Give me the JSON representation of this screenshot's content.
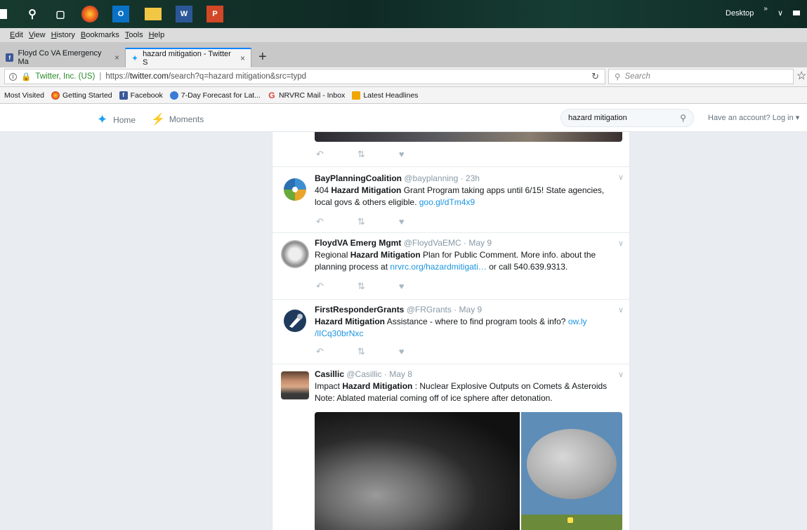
{
  "taskbar": {
    "right_label": "Desktop",
    "chevron": "»"
  },
  "menubar": [
    "Edit",
    "View",
    "History",
    "Bookmarks",
    "Tools",
    "Help"
  ],
  "tabs": [
    {
      "label": "Floyd Co VA Emergency Ma",
      "close": "×"
    },
    {
      "label": "hazard mitigation - Twitter S",
      "close": "×"
    }
  ],
  "newtab": "+",
  "url": {
    "org": "Twitter, Inc. (US)",
    "prefix": "https://",
    "host": "twitter.com",
    "path": "/search?q=hazard mitigation&src=typd"
  },
  "search_placeholder": "Search",
  "bookmarks": [
    {
      "label": "Most Visited"
    },
    {
      "label": "Getting Started"
    },
    {
      "label": "Facebook"
    },
    {
      "label": "7-Day Forecast for Lat..."
    },
    {
      "label": "NRVRC Mail - Inbox"
    },
    {
      "label": "Latest Headlines"
    }
  ],
  "twitter_nav": {
    "home": "Home",
    "moments": "Moments",
    "search_value": "hazard mitigation",
    "login": "Have an account? Log in ▾"
  },
  "tweets": [
    {
      "name": "BayPlanningCoalition",
      "handle": "@bayplanning · 23h",
      "pre": "404 ",
      "bold": "Hazard Mitigation",
      "post": " Grant Program taking apps until 6/15! State agencies, local govs & others eligible. ",
      "link": "goo.gl/dTm4x9",
      "tail": ""
    },
    {
      "name": "FloydVA Emerg Mgmt",
      "handle": "@FloydVaEMC · May 9",
      "pre": "Regional ",
      "bold": "Hazard Mitigation",
      "post": " Plan for Public Comment. More info. about the planning process at ",
      "link": "nrvrc.org/hazardmitigati…",
      "tail": " or call 540.639.9313."
    },
    {
      "name": "FirstResponderGrants",
      "handle": "@FRGrants · May 9",
      "pre": "",
      "bold": "Hazard Mitigation",
      "post": " Assistance - where to find program tools & info? ",
      "link": "ow.ly /lICq30brNxc",
      "tail": ""
    },
    {
      "name": "Casillic",
      "handle": "@Casillic · May 8",
      "pre": "Impact ",
      "bold": "Hazard Mitigation",
      "post": " : Nuclear Explosive Outputs on Comets & Asteroids Note: Ablated material coming off of ice sphere after detonation.",
      "link": "",
      "tail": ""
    }
  ]
}
